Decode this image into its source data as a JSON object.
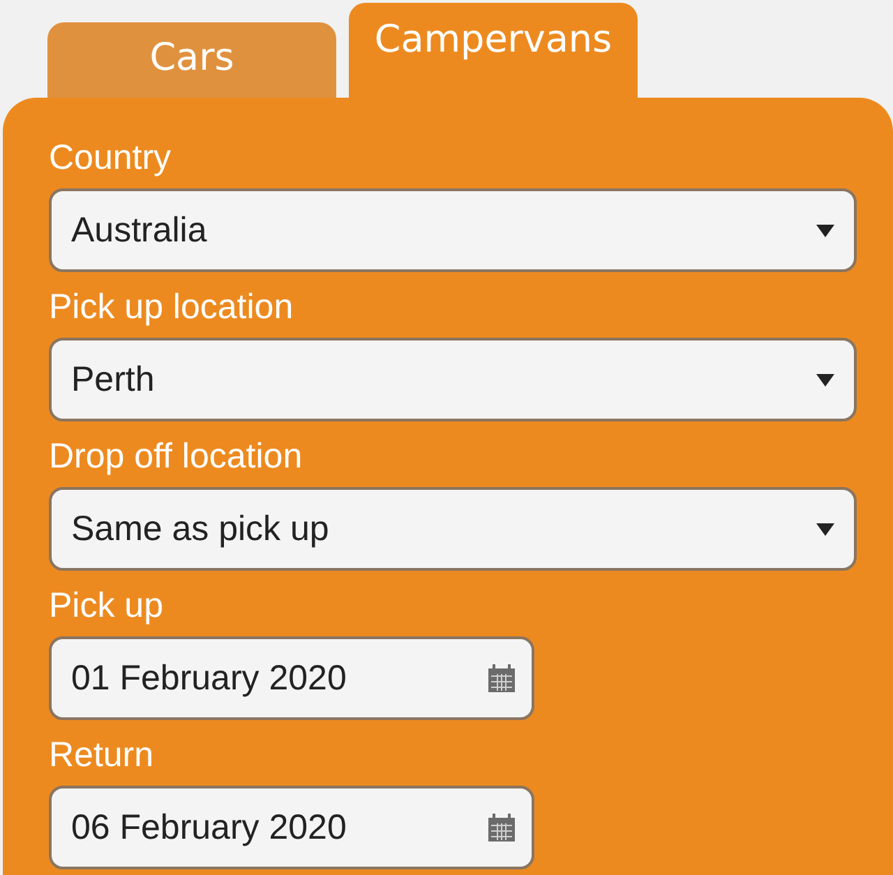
{
  "tabs": [
    {
      "label": "Cars",
      "selected": false
    },
    {
      "label": "Campervans",
      "selected": true
    }
  ],
  "fields": [
    {
      "label": "Country",
      "kind": "select",
      "value": "Australia"
    },
    {
      "label": "Pick up location",
      "kind": "select",
      "value": "Perth"
    },
    {
      "label": "Drop off location",
      "kind": "select",
      "value": "Same as pick up"
    },
    {
      "label": "Pick up",
      "kind": "date",
      "value": "01 February 2020"
    },
    {
      "label": "Return",
      "kind": "date",
      "value": "06 February 2020"
    }
  ]
}
